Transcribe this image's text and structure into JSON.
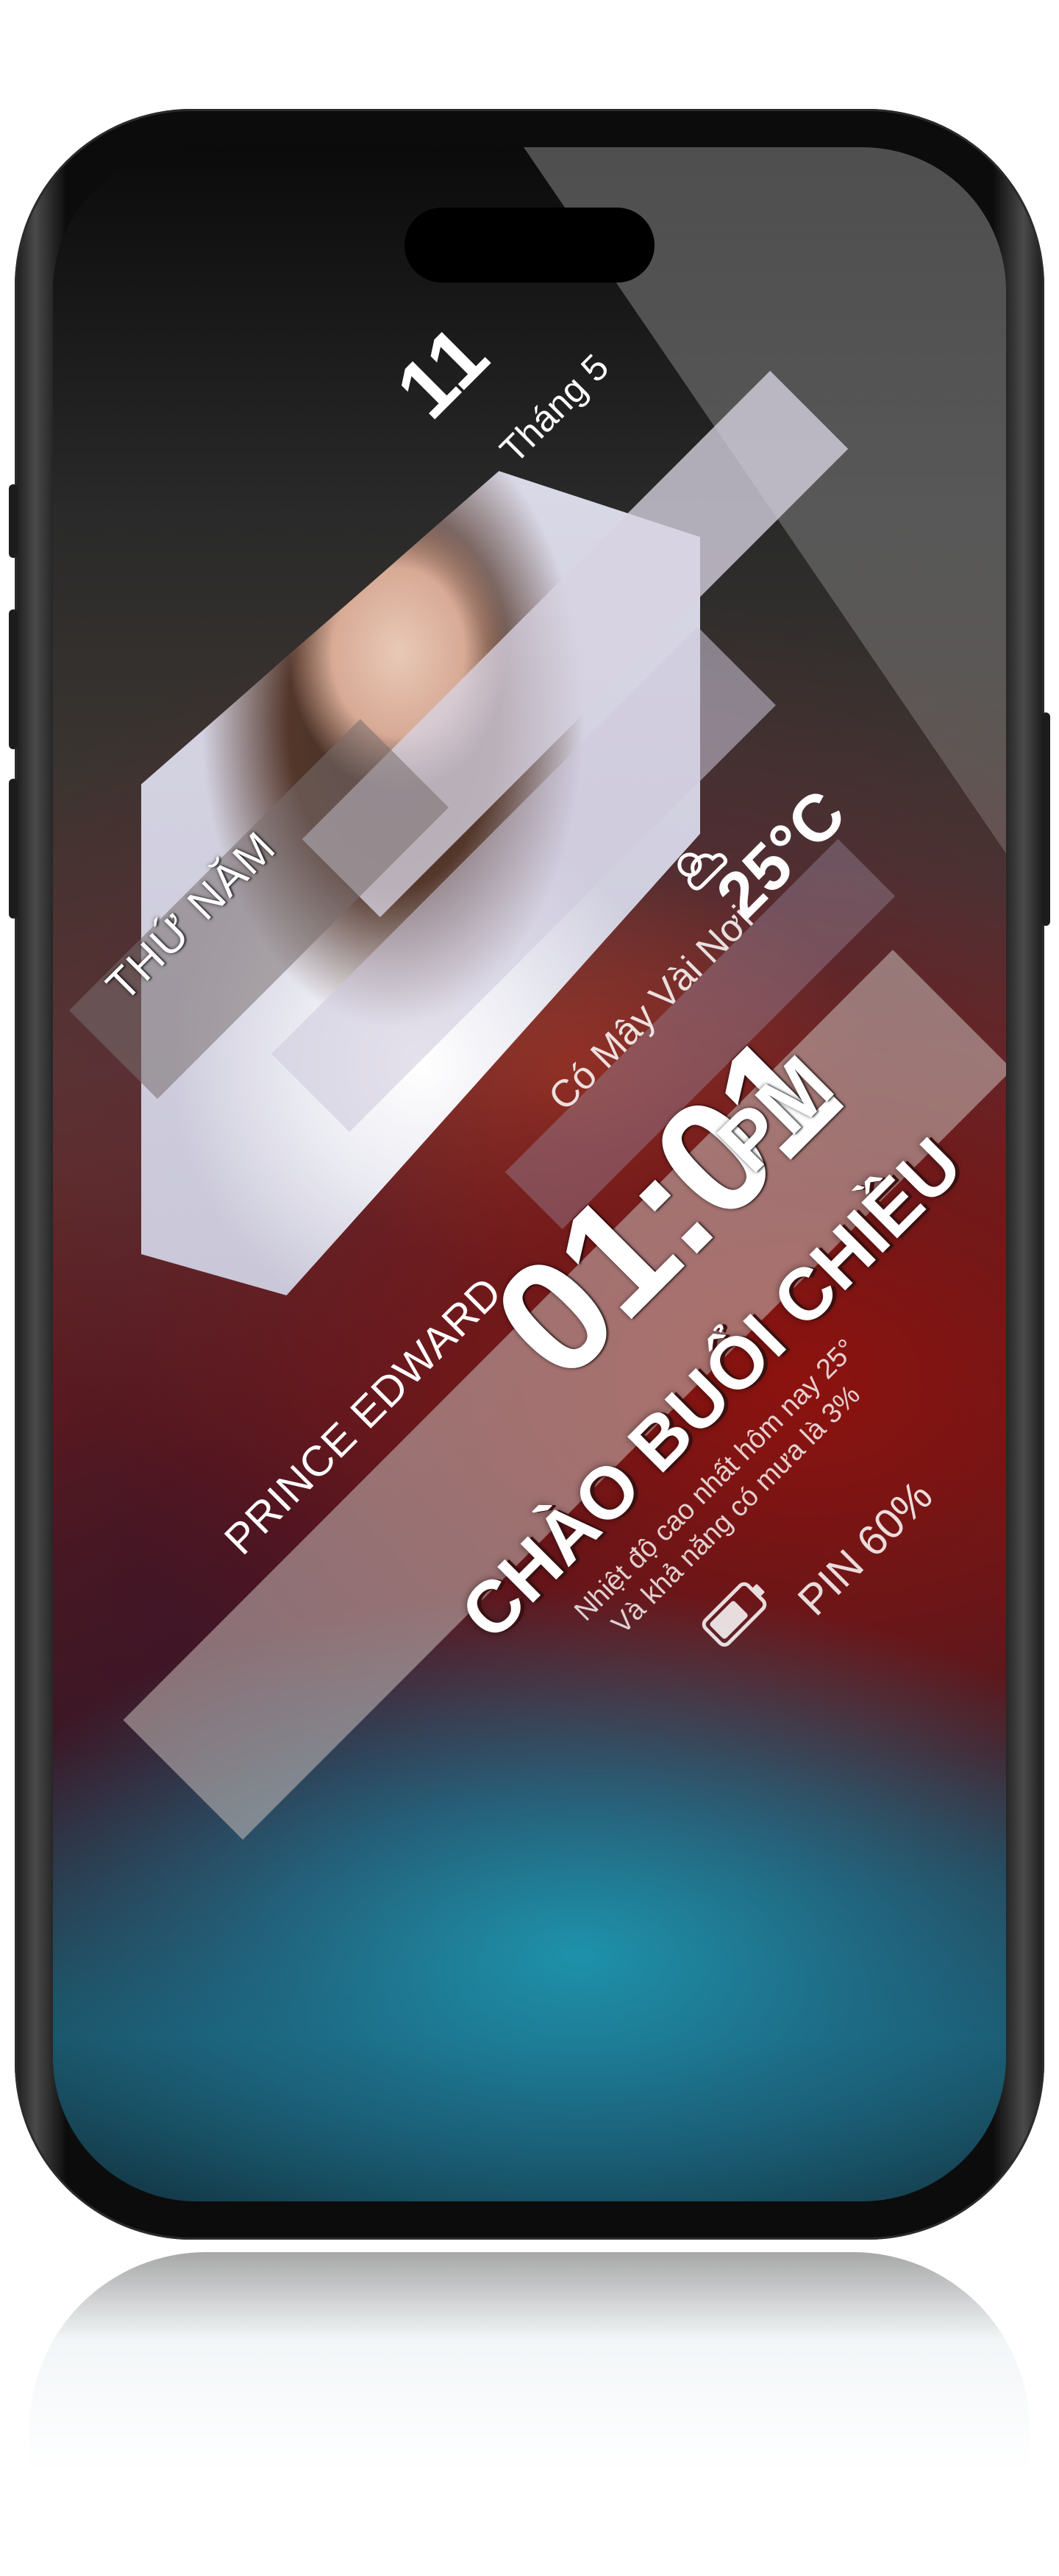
{
  "lockscreen": {
    "date_day": "11",
    "date_month": "Tháng 5",
    "weekday": "THỨ NĂM",
    "temperature": "25°C",
    "weather_desc": "Có Mây Vài Nơi",
    "time": "01:01",
    "ampm": "PM",
    "location": "PRINCE EDWARD",
    "greeting": "CHÀO BUỔI CHIỀU",
    "forecast_line1": "Nhiệt độ cao nhất hôm nay 25°",
    "forecast_line2": "Và khả năng có mưa là 3%",
    "battery_label": "PIN 60%",
    "battery_level": 0.6
  },
  "icons": {
    "weather": "partly-cloudy-icon",
    "battery": "battery-icon"
  },
  "colors": {
    "text": "#ffffff",
    "band": "#bdb7b2",
    "wallpaper_red": "#8c120e",
    "wallpaper_teal": "#1e96af"
  }
}
